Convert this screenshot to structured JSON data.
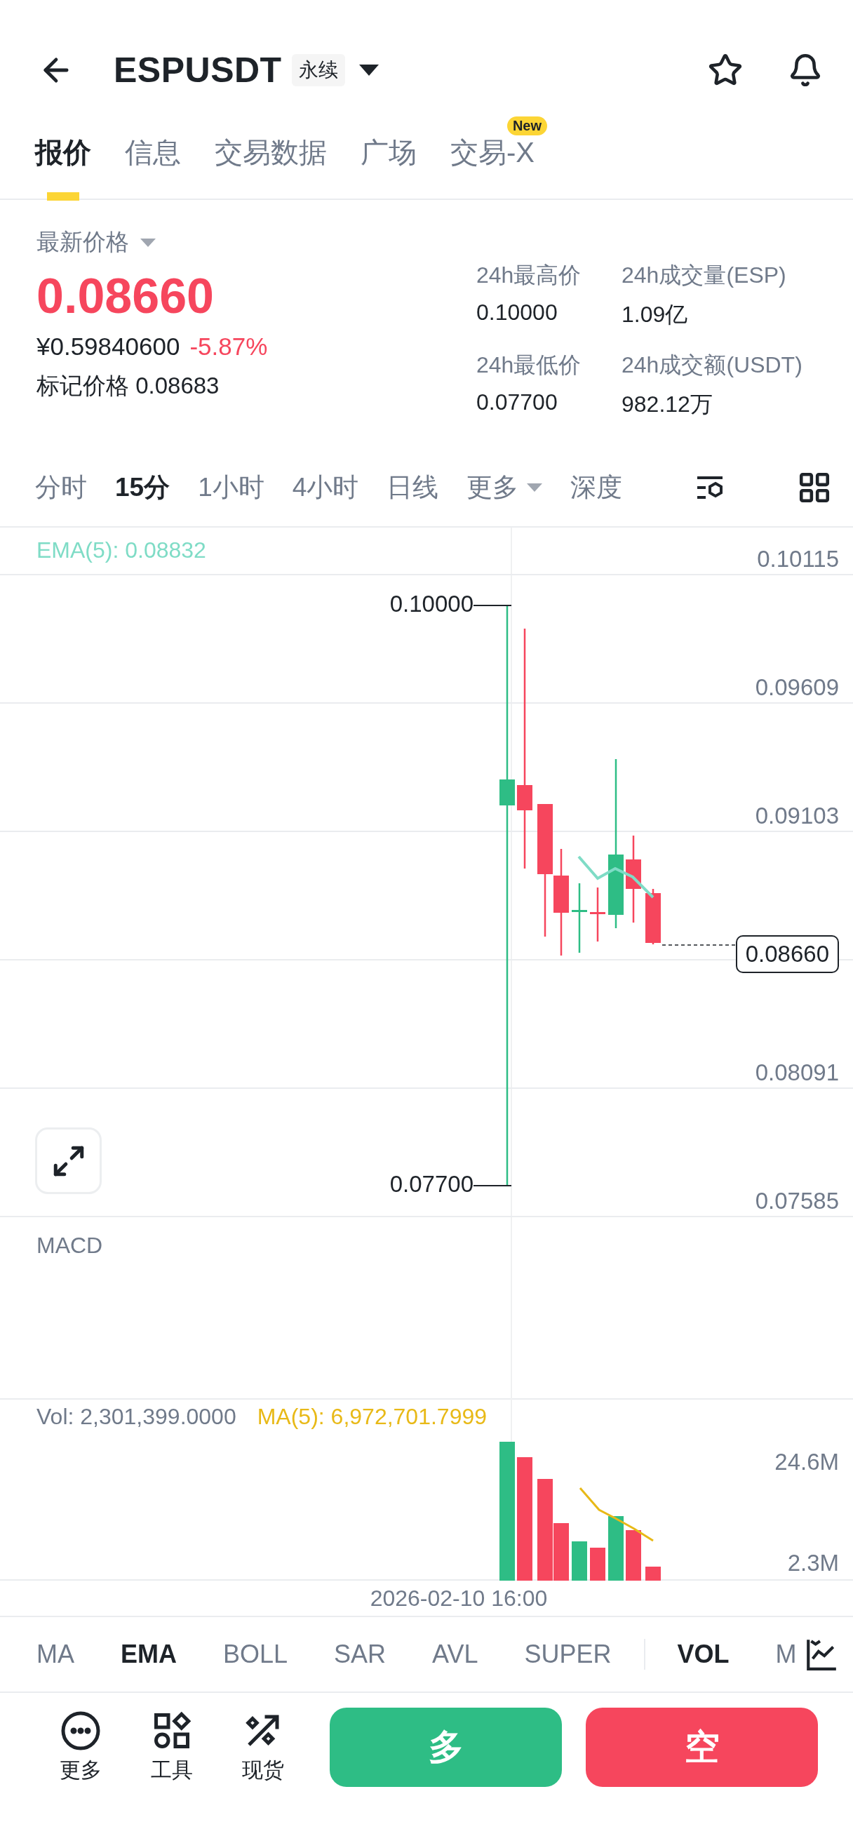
{
  "header": {
    "symbol": "ESPUSDT",
    "badge": "永续"
  },
  "tabs": [
    {
      "label": "报价",
      "selected": true
    },
    {
      "label": "信息",
      "selected": false
    },
    {
      "label": "交易数据",
      "selected": false
    },
    {
      "label": "广场",
      "selected": false
    },
    {
      "label": "交易-X",
      "selected": false,
      "badge": "New"
    }
  ],
  "price": {
    "label": "最新价格",
    "last": "0.08660",
    "fiat": "¥0.59840600",
    "change": "-5.87%",
    "mark_label": "标记价格",
    "mark_value": "0.08683"
  },
  "stats": [
    {
      "label": "24h最高价",
      "value": "0.10000"
    },
    {
      "label": "24h成交量(ESP)",
      "value": "1.09亿"
    },
    {
      "label": "24h最低价",
      "value": "0.07700"
    },
    {
      "label": "24h成交额(USDT)",
      "value": "982.12万"
    }
  ],
  "intervals": [
    {
      "label": "分时",
      "selected": false
    },
    {
      "label": "15分",
      "selected": true
    },
    {
      "label": "1小时",
      "selected": false
    },
    {
      "label": "4小时",
      "selected": false
    },
    {
      "label": "日线",
      "selected": false
    },
    {
      "label": "更多",
      "selected": false,
      "dropdown": true
    },
    {
      "label": "深度",
      "selected": false
    }
  ],
  "chart": {
    "ema_label": "EMA(5): 0.08832",
    "high_label": "0.10000",
    "low_label": "0.07700",
    "y_labels": [
      {
        "kind": "tick",
        "label": "0.10115"
      },
      {
        "kind": "tick",
        "label": "0.09609"
      },
      {
        "kind": "tick",
        "label": "0.09103"
      },
      {
        "kind": "price",
        "label": "0.08660"
      },
      {
        "kind": "tick",
        "label": "0.08091"
      },
      {
        "kind": "tick",
        "label": "0.07585"
      }
    ],
    "indicator": "MACD"
  },
  "volume": {
    "vol_label": "Vol: 2,301,399.0000",
    "ma_label": "MA(5): 6,972,701.7999",
    "y_labels": [
      "24.6M",
      "2.3M"
    ],
    "time": "2026-02-10 16:00"
  },
  "main_indicators": [
    {
      "label": "MA",
      "selected": false
    },
    {
      "label": "EMA",
      "selected": true
    },
    {
      "label": "BOLL",
      "selected": false
    },
    {
      "label": "SAR",
      "selected": false
    },
    {
      "label": "AVL",
      "selected": false
    },
    {
      "label": "SUPER",
      "selected": false
    }
  ],
  "sub_indicators": [
    {
      "label": "VOL",
      "selected": true
    },
    {
      "label": "M",
      "selected": false
    }
  ],
  "actions": [
    {
      "label": "更多",
      "kind": "more"
    },
    {
      "label": "工具",
      "kind": "tools"
    },
    {
      "label": "现货",
      "kind": "spot"
    }
  ],
  "trade": [
    {
      "label": "多",
      "kind": "long"
    },
    {
      "label": "空",
      "kind": "short"
    }
  ]
}
